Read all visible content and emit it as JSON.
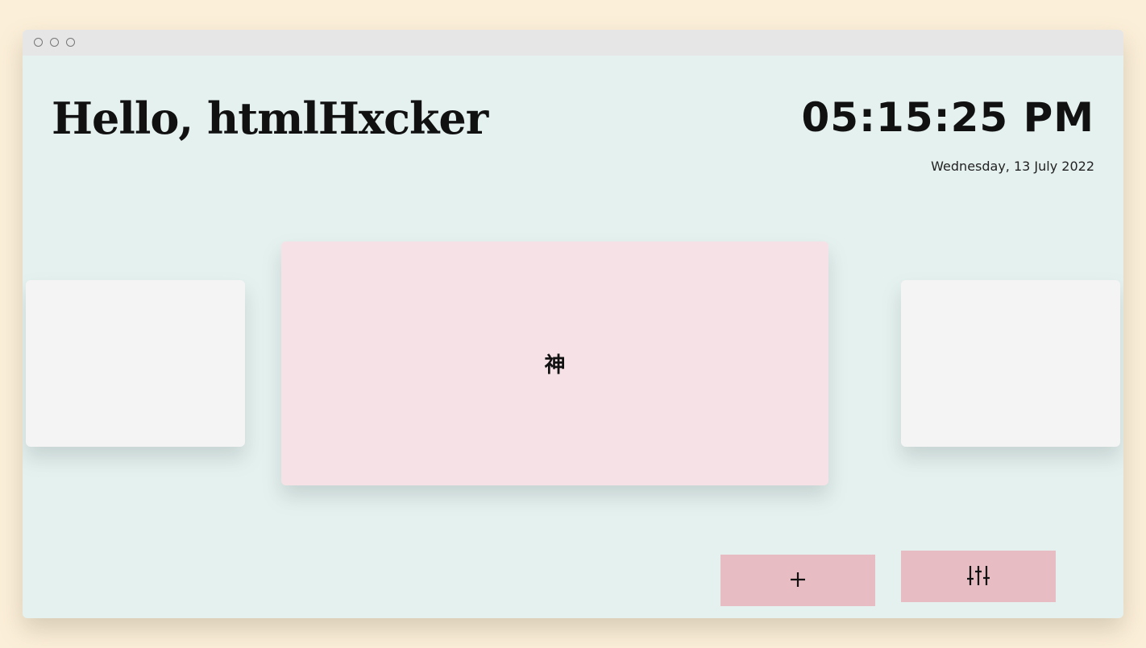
{
  "window": {
    "controls": [
      "window-dot",
      "window-dot",
      "window-dot"
    ]
  },
  "header": {
    "greeting": "Hello, htmlHxcker",
    "time": "05:15:25 PM",
    "date": "Wednesday, 13 July 2022"
  },
  "cards": {
    "left": {
      "content": ""
    },
    "main": {
      "content": "神"
    },
    "right": {
      "content": ""
    }
  },
  "actions": {
    "add_icon": "plus-icon",
    "settings_icon": "sliders-icon"
  },
  "colors": {
    "page_background": "#fcefd9",
    "window_background": "#e5f1ef",
    "titlebar": "#e6e6e6",
    "main_card": "#f6e2e6",
    "side_card": "#f4f4f4",
    "button": "#e8bcc3",
    "text": "#111111"
  }
}
